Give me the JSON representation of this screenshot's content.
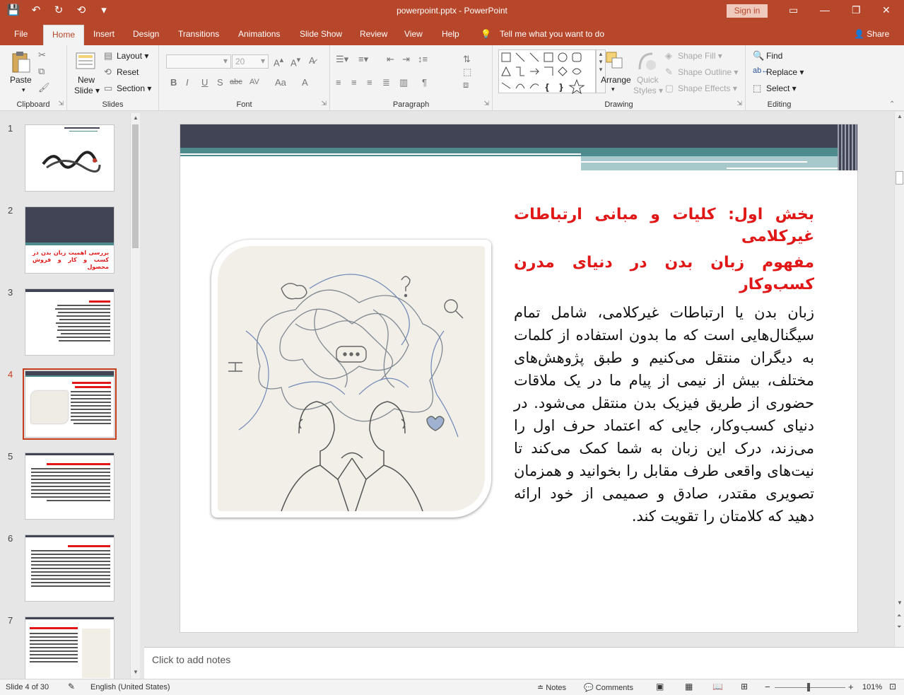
{
  "window": {
    "title": "powerpoint.pptx  -  PowerPoint",
    "signin": "Sign in"
  },
  "qat": {
    "save": "💾",
    "undo": "↶",
    "redo": "↻",
    "present": "⟲",
    "more": "▾"
  },
  "tabs": [
    "File",
    "Home",
    "Insert",
    "Design",
    "Transitions",
    "Animations",
    "Slide Show",
    "Review",
    "View",
    "Help"
  ],
  "active_tab": "Home",
  "tellme": "Tell me what you want to do",
  "share": "Share",
  "ribbon": {
    "clipboard": {
      "label": "Clipboard",
      "paste": "Paste"
    },
    "slides": {
      "label": "Slides",
      "new_slide_1": "New",
      "new_slide_2": "Slide ▾",
      "layout": "Layout ▾",
      "reset": "Reset",
      "section": "Section ▾"
    },
    "font": {
      "label": "Font",
      "font_size": "20",
      "bold": "B",
      "italic": "I",
      "underline": "U",
      "shadow": "S",
      "strike": "abc",
      "spacing": "AV",
      "case": "Aa",
      "color": "A"
    },
    "paragraph": {
      "label": "Paragraph"
    },
    "drawing": {
      "label": "Drawing",
      "arrange": "Arrange",
      "quick_styles_1": "Quick",
      "quick_styles_2": "Styles ▾",
      "shape_fill": "Shape Fill ▾",
      "shape_outline": "Shape Outline ▾",
      "shape_effects": "Shape Effects ▾"
    },
    "editing": {
      "label": "Editing",
      "find": "Find",
      "replace": "Replace ▾",
      "select": "Select ▾"
    }
  },
  "thumbnails": [
    {
      "num": "1"
    },
    {
      "num": "2",
      "text": "بررسی اهمیت زبان بدن در کسب و کار و فروش محصول"
    },
    {
      "num": "3"
    },
    {
      "num": "4"
    },
    {
      "num": "5"
    },
    {
      "num": "6"
    },
    {
      "num": "7"
    }
  ],
  "active_slide": 4,
  "slide": {
    "heading1": "بخش اول: کلیات و مبانی ارتباطات غیرکلامی",
    "heading2": "مفهوم زبان بدن در دنیای مدرن کسب‌وکار",
    "body": "زبان بدن یا ارتباطات غیرکلامی، شامل تمام سیگنال‌هایی است که ما بدون استفاده از کلمات به دیگران منتقل می‌کنیم و طبق پژوهش‌های مختلف، بیش از نیمی از پیام ما در یک ملاقات حضوری از طریق فیزیک بدن منتقل می‌شود. در دنیای کسب‌وکار، جایی که اعتماد حرف اول را می‌زند، درک این زبان به شما کمک می‌کند تا نیت‌های واقعی طرف مقابل را بخوانید و همزمان تصویری مقتدر، صادق و صمیمی از خود ارائه دهید که کلامتان را تقویت کند."
  },
  "notes_placeholder": "Click to add notes",
  "status": {
    "slide_info": "Slide 4 of 30",
    "language": "English (United States)",
    "notes": "Notes",
    "comments": "Comments",
    "zoom": "101%"
  },
  "colors": {
    "accent": "#b7472a",
    "slide_header": "#414455",
    "slide_teal": "#4d8b8e",
    "heading_red": "#e11717"
  }
}
